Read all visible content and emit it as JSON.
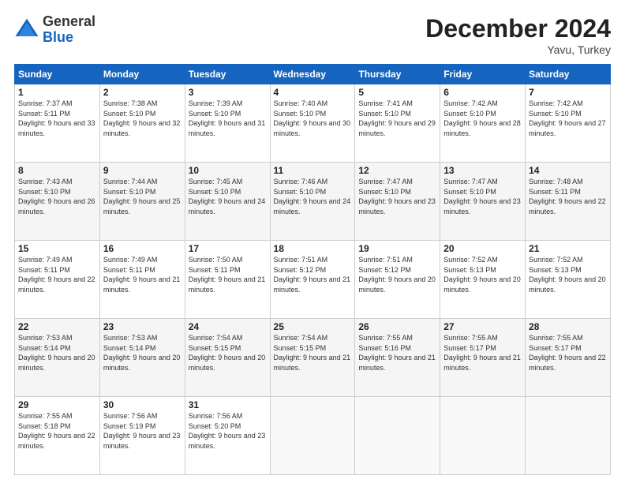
{
  "logo": {
    "general": "General",
    "blue": "Blue"
  },
  "header": {
    "month": "December 2024",
    "location": "Yavu, Turkey"
  },
  "weekdays": [
    "Sunday",
    "Monday",
    "Tuesday",
    "Wednesday",
    "Thursday",
    "Friday",
    "Saturday"
  ],
  "weeks": [
    [
      {
        "day": "1",
        "sunrise": "Sunrise: 7:37 AM",
        "sunset": "Sunset: 5:11 PM",
        "daylight": "Daylight: 9 hours and 33 minutes."
      },
      {
        "day": "2",
        "sunrise": "Sunrise: 7:38 AM",
        "sunset": "Sunset: 5:10 PM",
        "daylight": "Daylight: 9 hours and 32 minutes."
      },
      {
        "day": "3",
        "sunrise": "Sunrise: 7:39 AM",
        "sunset": "Sunset: 5:10 PM",
        "daylight": "Daylight: 9 hours and 31 minutes."
      },
      {
        "day": "4",
        "sunrise": "Sunrise: 7:40 AM",
        "sunset": "Sunset: 5:10 PM",
        "daylight": "Daylight: 9 hours and 30 minutes."
      },
      {
        "day": "5",
        "sunrise": "Sunrise: 7:41 AM",
        "sunset": "Sunset: 5:10 PM",
        "daylight": "Daylight: 9 hours and 29 minutes."
      },
      {
        "day": "6",
        "sunrise": "Sunrise: 7:42 AM",
        "sunset": "Sunset: 5:10 PM",
        "daylight": "Daylight: 9 hours and 28 minutes."
      },
      {
        "day": "7",
        "sunrise": "Sunrise: 7:42 AM",
        "sunset": "Sunset: 5:10 PM",
        "daylight": "Daylight: 9 hours and 27 minutes."
      }
    ],
    [
      {
        "day": "8",
        "sunrise": "Sunrise: 7:43 AM",
        "sunset": "Sunset: 5:10 PM",
        "daylight": "Daylight: 9 hours and 26 minutes."
      },
      {
        "day": "9",
        "sunrise": "Sunrise: 7:44 AM",
        "sunset": "Sunset: 5:10 PM",
        "daylight": "Daylight: 9 hours and 25 minutes."
      },
      {
        "day": "10",
        "sunrise": "Sunrise: 7:45 AM",
        "sunset": "Sunset: 5:10 PM",
        "daylight": "Daylight: 9 hours and 24 minutes."
      },
      {
        "day": "11",
        "sunrise": "Sunrise: 7:46 AM",
        "sunset": "Sunset: 5:10 PM",
        "daylight": "Daylight: 9 hours and 24 minutes."
      },
      {
        "day": "12",
        "sunrise": "Sunrise: 7:47 AM",
        "sunset": "Sunset: 5:10 PM",
        "daylight": "Daylight: 9 hours and 23 minutes."
      },
      {
        "day": "13",
        "sunrise": "Sunrise: 7:47 AM",
        "sunset": "Sunset: 5:10 PM",
        "daylight": "Daylight: 9 hours and 23 minutes."
      },
      {
        "day": "14",
        "sunrise": "Sunrise: 7:48 AM",
        "sunset": "Sunset: 5:11 PM",
        "daylight": "Daylight: 9 hours and 22 minutes."
      }
    ],
    [
      {
        "day": "15",
        "sunrise": "Sunrise: 7:49 AM",
        "sunset": "Sunset: 5:11 PM",
        "daylight": "Daylight: 9 hours and 22 minutes."
      },
      {
        "day": "16",
        "sunrise": "Sunrise: 7:49 AM",
        "sunset": "Sunset: 5:11 PM",
        "daylight": "Daylight: 9 hours and 21 minutes."
      },
      {
        "day": "17",
        "sunrise": "Sunrise: 7:50 AM",
        "sunset": "Sunset: 5:11 PM",
        "daylight": "Daylight: 9 hours and 21 minutes."
      },
      {
        "day": "18",
        "sunrise": "Sunrise: 7:51 AM",
        "sunset": "Sunset: 5:12 PM",
        "daylight": "Daylight: 9 hours and 21 minutes."
      },
      {
        "day": "19",
        "sunrise": "Sunrise: 7:51 AM",
        "sunset": "Sunset: 5:12 PM",
        "daylight": "Daylight: 9 hours and 20 minutes."
      },
      {
        "day": "20",
        "sunrise": "Sunrise: 7:52 AM",
        "sunset": "Sunset: 5:13 PM",
        "daylight": "Daylight: 9 hours and 20 minutes."
      },
      {
        "day": "21",
        "sunrise": "Sunrise: 7:52 AM",
        "sunset": "Sunset: 5:13 PM",
        "daylight": "Daylight: 9 hours and 20 minutes."
      }
    ],
    [
      {
        "day": "22",
        "sunrise": "Sunrise: 7:53 AM",
        "sunset": "Sunset: 5:14 PM",
        "daylight": "Daylight: 9 hours and 20 minutes."
      },
      {
        "day": "23",
        "sunrise": "Sunrise: 7:53 AM",
        "sunset": "Sunset: 5:14 PM",
        "daylight": "Daylight: 9 hours and 20 minutes."
      },
      {
        "day": "24",
        "sunrise": "Sunrise: 7:54 AM",
        "sunset": "Sunset: 5:15 PM",
        "daylight": "Daylight: 9 hours and 20 minutes."
      },
      {
        "day": "25",
        "sunrise": "Sunrise: 7:54 AM",
        "sunset": "Sunset: 5:15 PM",
        "daylight": "Daylight: 9 hours and 21 minutes."
      },
      {
        "day": "26",
        "sunrise": "Sunrise: 7:55 AM",
        "sunset": "Sunset: 5:16 PM",
        "daylight": "Daylight: 9 hours and 21 minutes."
      },
      {
        "day": "27",
        "sunrise": "Sunrise: 7:55 AM",
        "sunset": "Sunset: 5:17 PM",
        "daylight": "Daylight: 9 hours and 21 minutes."
      },
      {
        "day": "28",
        "sunrise": "Sunrise: 7:55 AM",
        "sunset": "Sunset: 5:17 PM",
        "daylight": "Daylight: 9 hours and 22 minutes."
      }
    ],
    [
      {
        "day": "29",
        "sunrise": "Sunrise: 7:55 AM",
        "sunset": "Sunset: 5:18 PM",
        "daylight": "Daylight: 9 hours and 22 minutes."
      },
      {
        "day": "30",
        "sunrise": "Sunrise: 7:56 AM",
        "sunset": "Sunset: 5:19 PM",
        "daylight": "Daylight: 9 hours and 23 minutes."
      },
      {
        "day": "31",
        "sunrise": "Sunrise: 7:56 AM",
        "sunset": "Sunset: 5:20 PM",
        "daylight": "Daylight: 9 hours and 23 minutes."
      },
      null,
      null,
      null,
      null
    ]
  ]
}
